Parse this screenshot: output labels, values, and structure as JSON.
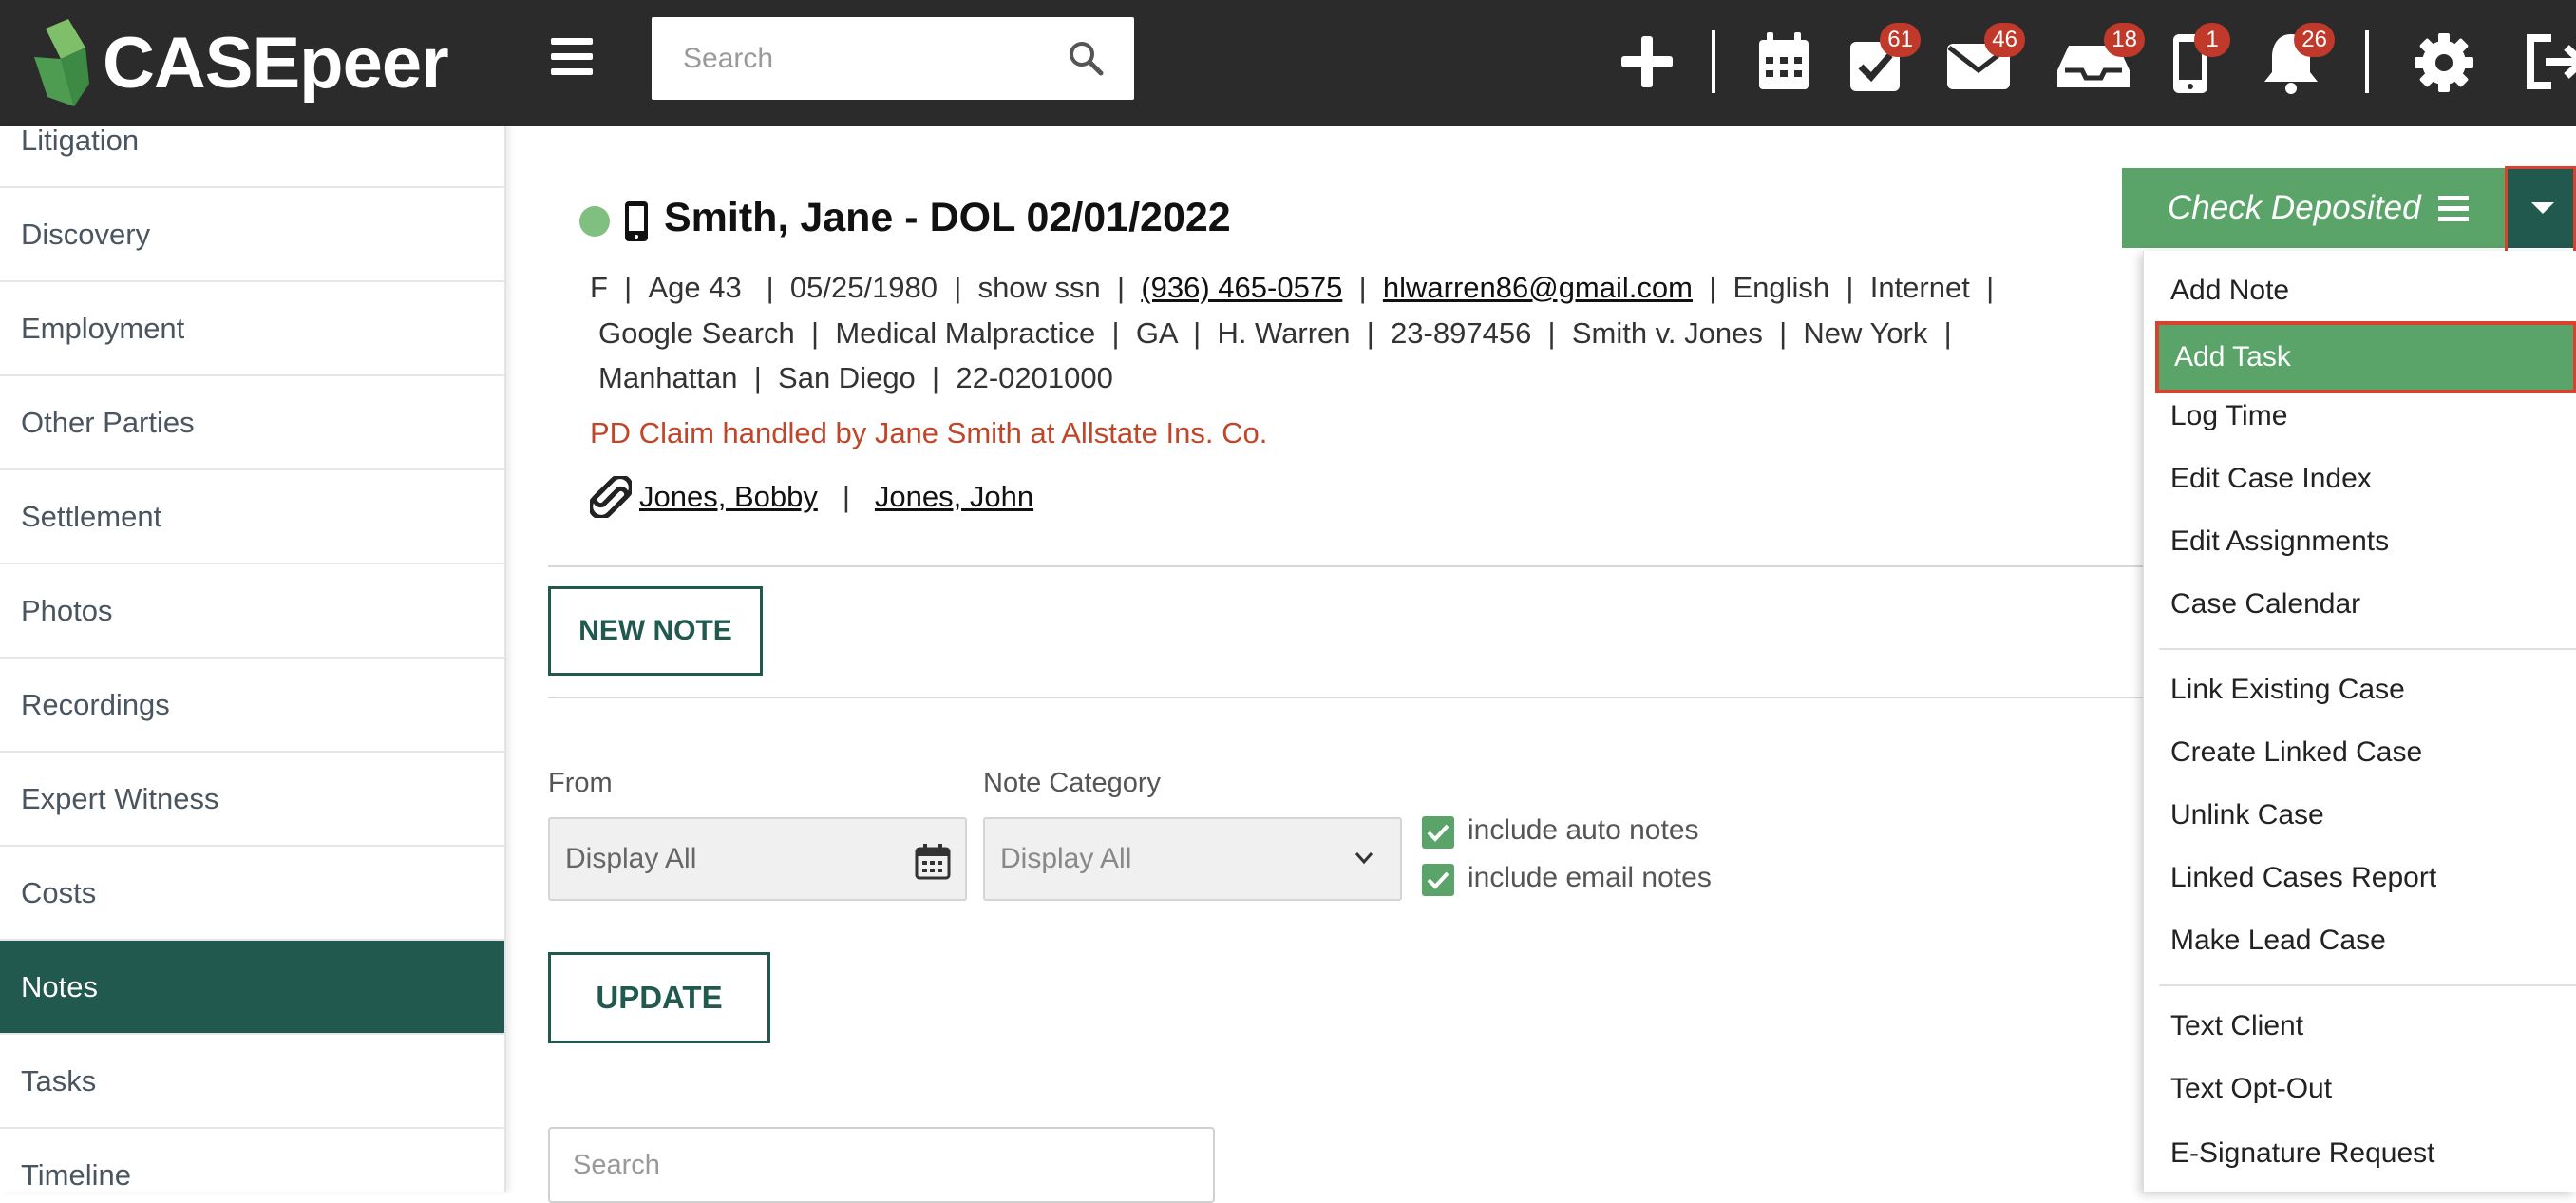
{
  "app": {
    "logo_text": "CASEpeer"
  },
  "topbar": {
    "search_placeholder": "Search",
    "badges": {
      "tasks": "61",
      "mail": "46",
      "inbox": "18",
      "phone": "1",
      "notifications": "26"
    }
  },
  "sidebar": {
    "items": [
      {
        "label": "Litigation"
      },
      {
        "label": "Discovery"
      },
      {
        "label": "Employment"
      },
      {
        "label": "Other Parties"
      },
      {
        "label": "Settlement"
      },
      {
        "label": "Photos"
      },
      {
        "label": "Recordings"
      },
      {
        "label": "Expert Witness"
      },
      {
        "label": "Costs"
      },
      {
        "label": "Notes"
      },
      {
        "label": "Tasks"
      },
      {
        "label": "Timeline"
      }
    ]
  },
  "case": {
    "title": "Smith, Jane - DOL 02/01/2022",
    "line1": {
      "gender": "F",
      "age": "Age 43",
      "dob": "05/25/1980",
      "ssn": "show ssn",
      "phone": "(936) 465-0575",
      "email": "hlwarren86@gmail.com",
      "language": "English",
      "source": "Internet"
    },
    "line2": {
      "referral": "Google Search",
      "case_type": "Medical Malpractice",
      "state": "GA",
      "attorney": "H. Warren",
      "case_no": "23-897456",
      "caption": "Smith v. Jones",
      "venue": "New York"
    },
    "line3": {
      "county": "Manhattan",
      "office": "San Diego",
      "file_no": "22-0201000"
    },
    "pd_claim": "PD Claim handled by Jane Smith at Allstate Ins. Co.",
    "linked_cases": [
      "Jones, Bobby",
      "Jones, John"
    ],
    "separator": "|"
  },
  "notes": {
    "new_note_label": "NEW NOTE",
    "from_label": "From",
    "from_value": "Display All",
    "category_label": "Note Category",
    "category_value": "Display All",
    "include_auto": "include auto notes",
    "include_email": "include email notes",
    "update_label": "UPDATE",
    "search_placeholder": "Search"
  },
  "action_button": {
    "label": "Check Deposited"
  },
  "dropdown": {
    "items": [
      {
        "label": "Add Note"
      },
      {
        "label": "Add Task"
      },
      {
        "label": "Log Time"
      },
      {
        "label": "Edit Case Index"
      },
      {
        "label": "Edit Assignments"
      },
      {
        "label": "Case Calendar"
      },
      {
        "label": "Link Existing Case"
      },
      {
        "label": "Create Linked Case"
      },
      {
        "label": "Unlink Case"
      },
      {
        "label": "Linked Cases Report"
      },
      {
        "label": "Make Lead Case"
      },
      {
        "label": "Text Client"
      },
      {
        "label": "Text Opt-Out"
      },
      {
        "label": "E-Signature Request"
      }
    ]
  }
}
